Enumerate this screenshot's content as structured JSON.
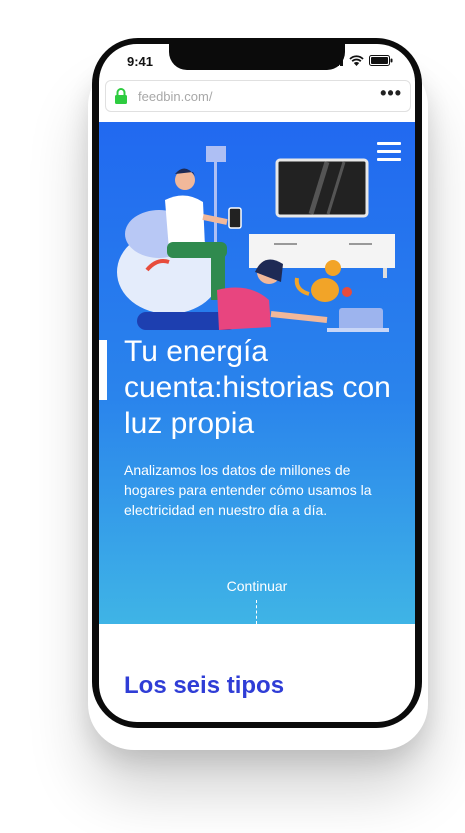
{
  "status_bar": {
    "time": "9:41"
  },
  "browser": {
    "url": "feedbin.com/",
    "more_label": "•••"
  },
  "hero": {
    "headline": "Tu energía cuenta:historias con luz propia",
    "subtitle": "Analizamos los datos de millones de hogares para entender cómo usamos la electricidad en nuestro día a día.",
    "continue_label": "Continuar"
  },
  "next_section": {
    "title": "Los seis tipos"
  },
  "colors": {
    "hero_top": "#2169f0",
    "hero_bottom": "#3fb4e6",
    "section_title": "#2f3dd6"
  },
  "icons": [
    "lock-icon",
    "signal-icon",
    "wifi-icon",
    "battery-icon",
    "more-icon",
    "menu-icon"
  ]
}
